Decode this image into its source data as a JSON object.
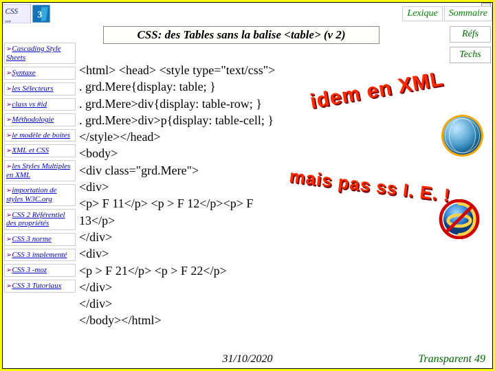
{
  "top_tabs": {
    "lexique": "Lexique",
    "sommaire": "Sommaire"
  },
  "title": "CSS: des Tables sans la balise <table> (v 2)",
  "right_side": {
    "refs": "Réfs",
    "techs": "Techs"
  },
  "nav": [
    "Cascading Style Sheets",
    "Syntaxe",
    "les Sélecteurs",
    "class vs #id",
    "Méthodologie",
    "le modèle de boites",
    "XML et CSS",
    "les Styles Multiples en XML",
    "importation de styles W3C.org",
    "CSS 2  Référentiel des propriétés",
    "CSS 3 norme",
    "CSS 3 implementé",
    "CSS 3 -moz",
    "CSS 3 Tutoriaux"
  ],
  "code_lines": [
    "<html> <head> <style type=\"text/css\">",
    ". grd.Mere{display: table; }",
    ". grd.Mere>div{display: table-row; }",
    ". grd.Mere>div>p{display: table-cell; }",
    "</style></head>",
    "<body>",
    "<div class=\"grd.Mere\">",
    "<div>",
    "<p> F 11</p> <p > F 12</p><p> F 13</p>",
    "</div>",
    "<div>",
    "<p > F 21</p> <p > F 22</p>",
    "</div>",
    "</div>",
    "</body></html>"
  ],
  "wordart": {
    "line1": "idem en XML",
    "line2": "mais pas ss I. E. !"
  },
  "footer": {
    "date": "31/10/2020",
    "transp": "Transparent 49"
  },
  "chevron": "➢"
}
